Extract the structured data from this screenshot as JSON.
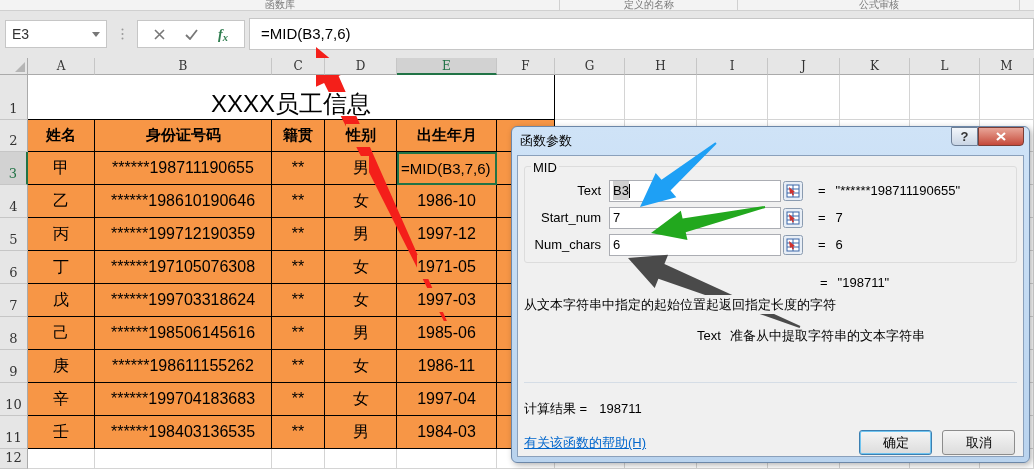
{
  "ribbon_groups": [
    "函数库",
    "定义的名称",
    "公式审核"
  ],
  "name_box": "E3",
  "function_button": "f$_{x}$",
  "formula": "=MID(B3,7,6)",
  "columns": [
    {
      "label": "A",
      "selected": false
    },
    {
      "label": "B",
      "selected": false
    },
    {
      "label": "C",
      "selected": false
    },
    {
      "label": "D",
      "selected": false
    },
    {
      "label": "E",
      "selected": true
    },
    {
      "label": "F",
      "selected": false
    },
    {
      "label": "G",
      "selected": false
    },
    {
      "label": "H",
      "selected": false
    },
    {
      "label": "I",
      "selected": false
    },
    {
      "label": "J",
      "selected": false
    },
    {
      "label": "K",
      "selected": false
    },
    {
      "label": "L",
      "selected": false
    },
    {
      "label": "M",
      "selected": false
    }
  ],
  "row_headers": [
    {
      "label": "1",
      "selected": false
    },
    {
      "label": "2",
      "selected": false
    },
    {
      "label": "3",
      "selected": true
    },
    {
      "label": "4",
      "selected": false
    },
    {
      "label": "5",
      "selected": false
    },
    {
      "label": "6",
      "selected": false
    },
    {
      "label": "7",
      "selected": false
    },
    {
      "label": "8",
      "selected": false
    },
    {
      "label": "9",
      "selected": false
    },
    {
      "label": "10",
      "selected": false
    },
    {
      "label": "11",
      "selected": false
    },
    {
      "label": "12",
      "selected": false
    }
  ],
  "title": "XXXX员工信息",
  "table": {
    "columns": [
      "姓名",
      "身份证号码",
      "籍贯",
      "性别",
      "出生年月"
    ],
    "rows": [
      [
        "甲",
        "******198711190655",
        "**",
        "男",
        "=MID(B3,7,6)"
      ],
      [
        "乙",
        "******198610190646",
        "**",
        "女",
        "1986-10"
      ],
      [
        "丙",
        "******199712190359",
        "**",
        "男",
        "1997-12"
      ],
      [
        "丁",
        "******197105076308",
        "**",
        "女",
        "1971-05"
      ],
      [
        "戊",
        "******199703318624",
        "**",
        "女",
        "1997-03"
      ],
      [
        "己",
        "******198506145616",
        "**",
        "男",
        "1985-06"
      ],
      [
        "庚",
        "******198611155262",
        "**",
        "女",
        "1986-11"
      ],
      [
        "辛",
        "******199704183683",
        "**",
        "女",
        "1997-04"
      ],
      [
        "壬",
        "******198403136535",
        "**",
        "男",
        "1984-03"
      ]
    ]
  },
  "dialog": {
    "title": "函数参数",
    "help_button": "?",
    "function_name": "MID",
    "arguments": [
      {
        "label": "Text",
        "value": "B3",
        "eq": "=",
        "result": "\"******198711190655\""
      },
      {
        "label": "Start_num",
        "value": "7",
        "eq": "=",
        "result": "7"
      },
      {
        "label": "Num_chars",
        "value": "6",
        "eq": "=",
        "result": "6"
      }
    ],
    "result_eq": "=",
    "result": "\"198711\"",
    "description": "从文本字符串中指定的起始位置起返回指定长度的字符",
    "argument_help": {
      "name": "Text",
      "text": "准备从中提取字符串的文本字符串"
    },
    "calc_label": "计算结果 =",
    "calc_value": "198711",
    "help_link": "有关该函数的帮助(H)",
    "buttons": [
      {
        "label": "确定",
        "default": true
      },
      {
        "label": "取消",
        "default": false
      }
    ]
  }
}
